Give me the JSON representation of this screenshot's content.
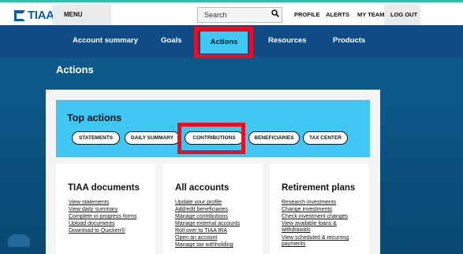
{
  "header": {
    "logo_text": "TIAA",
    "menu_label": "MENU",
    "search_placeholder": "Search",
    "links": [
      "PROFILE",
      "ALERTS",
      "MY TEAM"
    ],
    "logout_label": "LOG OUT"
  },
  "nav": {
    "items": [
      "Account summary",
      "Goals",
      "Actions",
      "Resources",
      "Products"
    ],
    "active": "Actions"
  },
  "page_title": "Actions",
  "top_actions": {
    "title": "Top actions",
    "buttons": [
      "STATEMENTS",
      "DAILY SUMMARY",
      "CONTRIBUTIONS",
      "BENEFICIARIES",
      "TAX CENTER"
    ]
  },
  "cards": [
    {
      "title": "TIAA documents",
      "links": [
        "View statements",
        "View daily summary",
        "Complete in-progress forms",
        "Upload documents",
        "Download to Quicken®"
      ]
    },
    {
      "title": "All accounts",
      "links": [
        "Update your profile",
        "Add/edit beneficiaries",
        "Manage contributions",
        "Manage external accounts",
        "Roll over to TIAA IRA",
        "Open an account",
        "Manage tax withholding"
      ]
    },
    {
      "title": "Retirement plans",
      "links": [
        "Research investments",
        "Change investments",
        "Check investment changes",
        "View available loans &",
        "withdrawals",
        "View scheduled & recurring",
        "payments"
      ]
    }
  ],
  "colors": {
    "accent": "#3fc6f2",
    "nav": "#0f4c87",
    "background": "#0d5a8a",
    "highlight": "#ef0c1e",
    "topline": "#2cc2a7"
  }
}
